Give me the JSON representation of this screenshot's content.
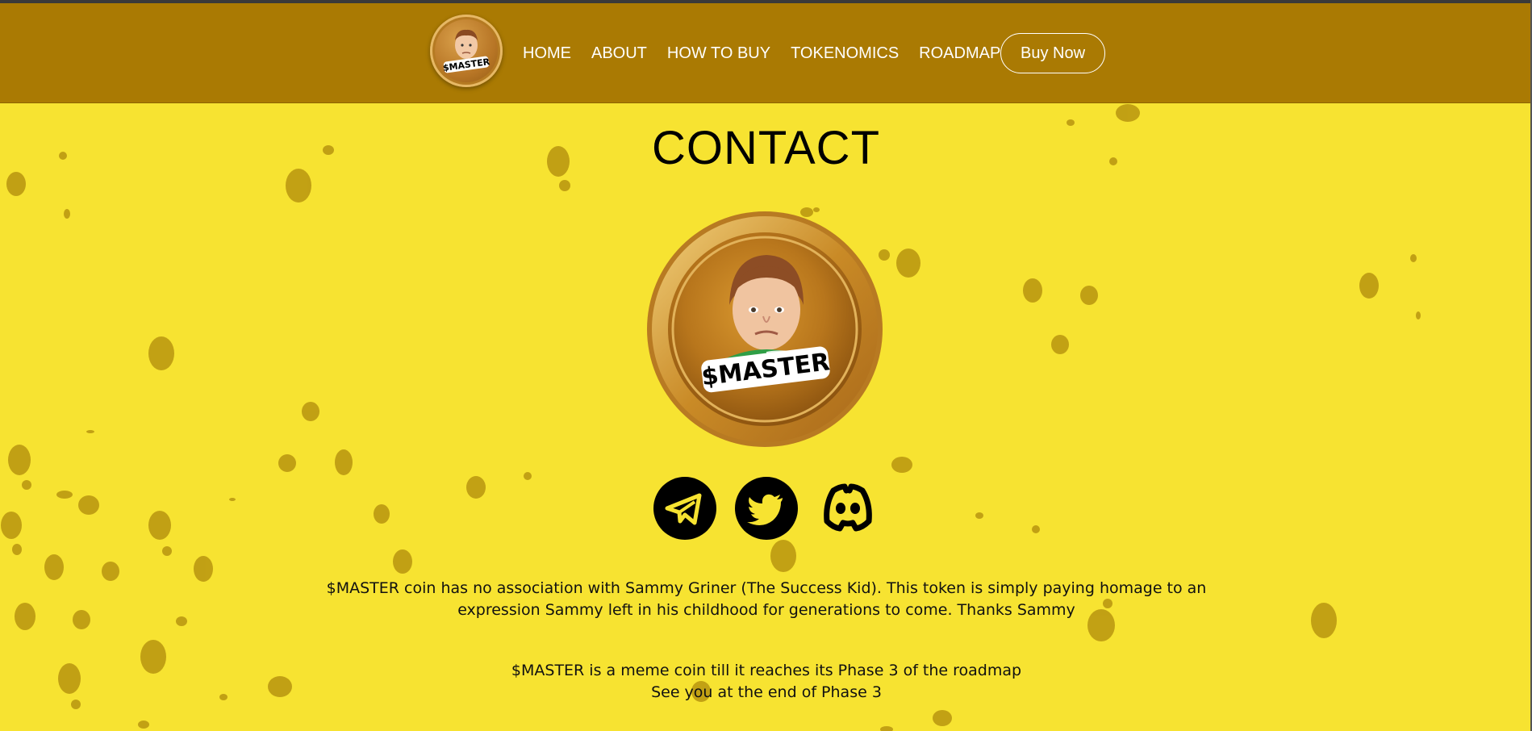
{
  "nav": {
    "logo_text": "$MASTER",
    "links": [
      "HOME",
      "ABOUT",
      "HOW TO BUY",
      "TOKENOMICS",
      "ROADMAP"
    ],
    "buy_label": "Buy Now"
  },
  "contact": {
    "title": "CONTACT",
    "coin_text": "$MASTER",
    "socials": [
      {
        "name": "telegram",
        "icon": "telegram-icon"
      },
      {
        "name": "twitter",
        "icon": "twitter-icon"
      },
      {
        "name": "discord",
        "icon": "discord-icon"
      }
    ],
    "disclaimer": "$MASTER coin has no association with Sammy Griner (The Success Kid). This token is simply paying homage to an expression Sammy left in his childhood for generations to come. Thanks Sammy",
    "note": "$MASTER is a meme coin till it reaches its Phase 3 of the roadmap See you at the end of Phase 3"
  },
  "colors": {
    "background": "#f7e331",
    "header": "#aa7a03",
    "spots": "#b8950f",
    "coin_gold": "#c98a26"
  }
}
